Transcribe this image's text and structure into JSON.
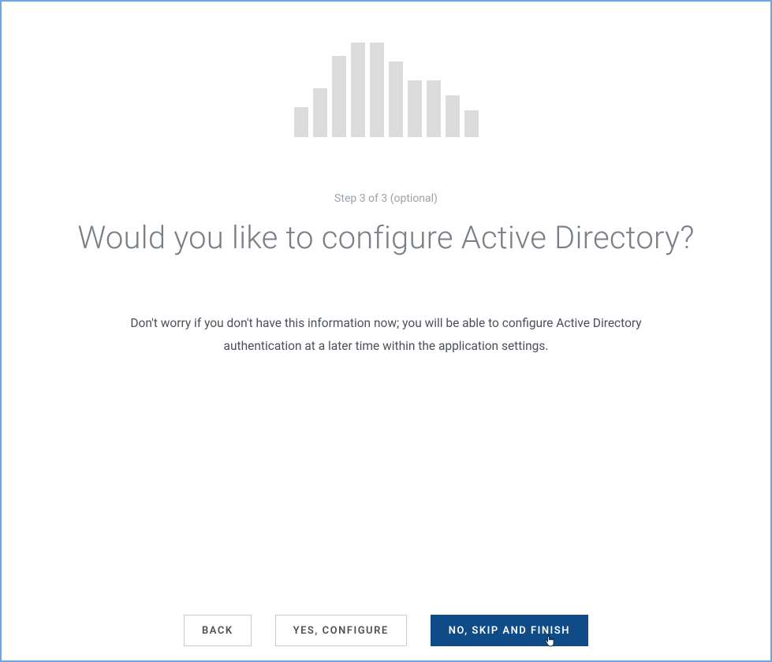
{
  "logo": {
    "bar_heights_pct": [
      32,
      52,
      86,
      100,
      100,
      80,
      60,
      60,
      44,
      28
    ]
  },
  "step_label": "Step 3 of 3 (optional)",
  "heading": "Would you like to configure Active Directory?",
  "description": "Don't worry if you don't have this information now; you will be able to configure Active Directory authentication at a later time within the application settings.",
  "buttons": {
    "back": "Back",
    "yes_configure": "Yes, Configure",
    "no_skip_finish": "No, Skip and Finish"
  },
  "colors": {
    "frame_border": "#6aa7e6",
    "primary_button_bg": "#0e4b87",
    "heading_text": "#7a7f86",
    "muted_text": "#9aa2a8",
    "body_text": "#4b5058",
    "logo_bar": "#dcdcdc",
    "outline_border": "#c9cdd2"
  }
}
